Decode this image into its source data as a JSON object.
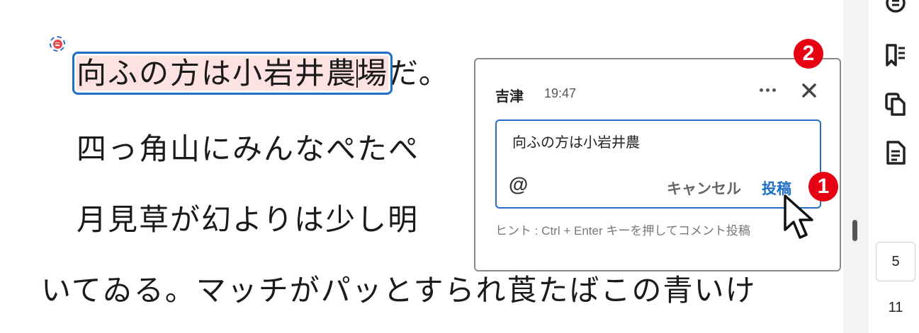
{
  "document": {
    "line1_selected": "向ふの方は小岩井農",
    "line1_selected_tail": "場",
    "line1_rest": "だ。",
    "line2": "四っ角山にみんなぺたぺ",
    "line3": "月見草が幻よりは少し明",
    "line4": "いてゐる。マッチがパッとすられ莨たばこの青いけ"
  },
  "comment_popup": {
    "author": "吉津",
    "time": "19:47",
    "input_value": "向ふの方は小岩井農",
    "mention_symbol": "@",
    "cancel_label": "キャンセル",
    "post_label": "投稿",
    "hint": "ヒント : Ctrl + Enter キーを押してコメント投稿"
  },
  "annotations": {
    "badge1": "1",
    "badge2": "2",
    "badge_color": "#e60012"
  },
  "sidebar": {
    "icons": [
      "comments-icon",
      "bookmarks-icon",
      "copy-icon",
      "page-info-icon"
    ],
    "current_page": "5",
    "total_pages": "11"
  },
  "colors": {
    "highlight_fill": "#fde2e2",
    "accent": "#1f6fc5"
  }
}
